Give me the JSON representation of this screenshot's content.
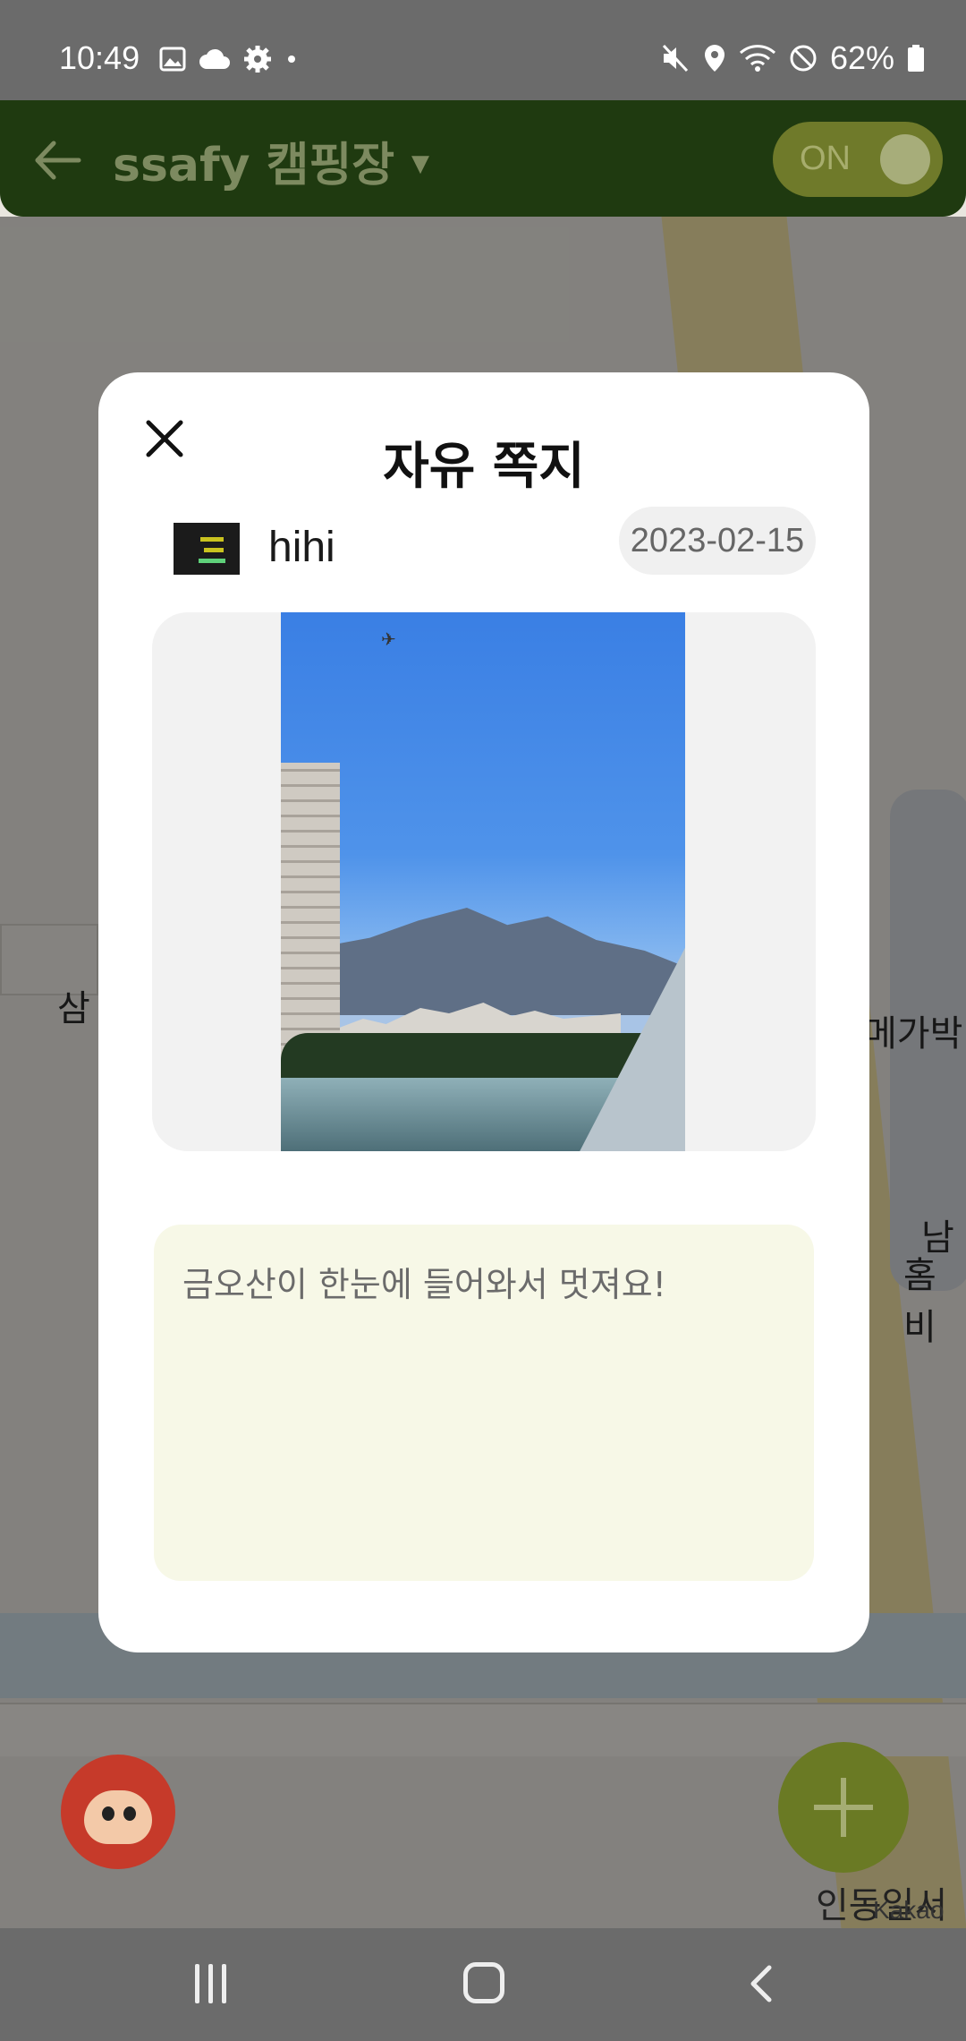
{
  "status_bar": {
    "time": "10:49",
    "battery": "62%",
    "left_icons": [
      "gallery-icon",
      "cloud-icon",
      "settings-icon",
      "dot-icon"
    ],
    "right_icons": [
      "mute-icon",
      "location-icon",
      "wifi-icon",
      "dnd-icon",
      "battery-icon"
    ]
  },
  "header": {
    "title": "ssafy 캠핑장",
    "toggle_label": "ON",
    "toggle_on": true
  },
  "map": {
    "labels": [
      "삼",
      "메가박",
      "남",
      "홈비",
      "인동일서"
    ],
    "watermark": "Kakao"
  },
  "modal": {
    "title": "자유 쪽지",
    "author": "hihi",
    "date": "2023-02-15",
    "message": "금오산이 한눈에 들어와서 멋져요!"
  },
  "colors": {
    "header_bg": "#1f3a10",
    "accent": "#6a7a24",
    "message_bg": "#f7f8e7",
    "date_badge_bg": "#f0f0f0"
  }
}
